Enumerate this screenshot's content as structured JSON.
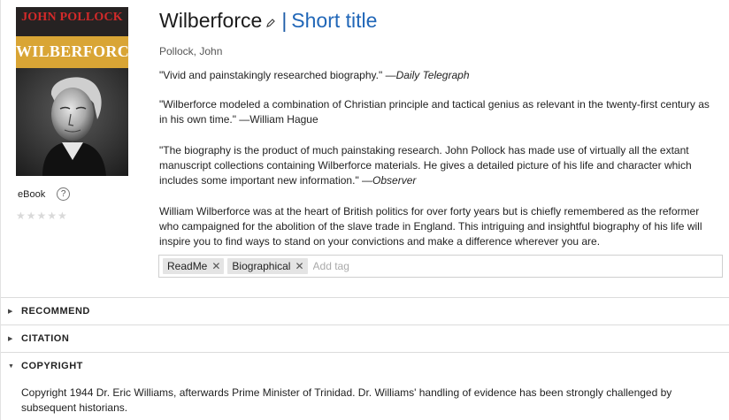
{
  "cover": {
    "author": "JOHN POLLOCK",
    "title": "WILBERFORCE"
  },
  "format": {
    "label": "eBook",
    "help": "?"
  },
  "rating": {
    "stars": "★★★★★",
    "value": 0,
    "max": 5
  },
  "book": {
    "title": "Wilberforce",
    "separator": "|",
    "short_title_link": "Short title",
    "author": "Pollock, John"
  },
  "reviews": [
    {
      "quote": "\"Vivid and painstakingly researched biography.\" —",
      "source": "Daily Telegraph"
    },
    {
      "quote": "\"Wilberforce modeled a combination of Christian principle and tactical genius as relevant in the twenty-first century as in his own time.\" —William Hague",
      "source": ""
    },
    {
      "quote": "\"The biography is the product of much painstaking research. John Pollock has made use of virtually all the extant manuscript collections containing Wilberforce materials. He gives a detailed picture of his life and character which includes some important new information.\" —",
      "source": "Observer"
    }
  ],
  "description": "William Wilberforce was at the heart of British politics for over forty years but is chiefly remembered as the reformer who campaigned for the abolition of the slave trade in England. This intriguing and insightful biography of his life will inspire you to find ways to stand on your convictions and make a difference wherever you are.",
  "tags": {
    "items": [
      "ReadMe",
      "Biographical"
    ],
    "remove_glyph": "✕",
    "placeholder": "Add tag"
  },
  "sections": {
    "recommend": {
      "label": "RECOMMEND",
      "caret": "▶"
    },
    "citation": {
      "label": "CITATION",
      "caret": "▶"
    },
    "copyright": {
      "label": "COPYRIGHT",
      "caret": "▼"
    }
  },
  "copyright_text": "Copyright 1944 Dr. Eric Williams, afterwards Prime Minister of Trinidad. Dr. Williams' handling of evidence has been strongly challenged by subsequent historians."
}
